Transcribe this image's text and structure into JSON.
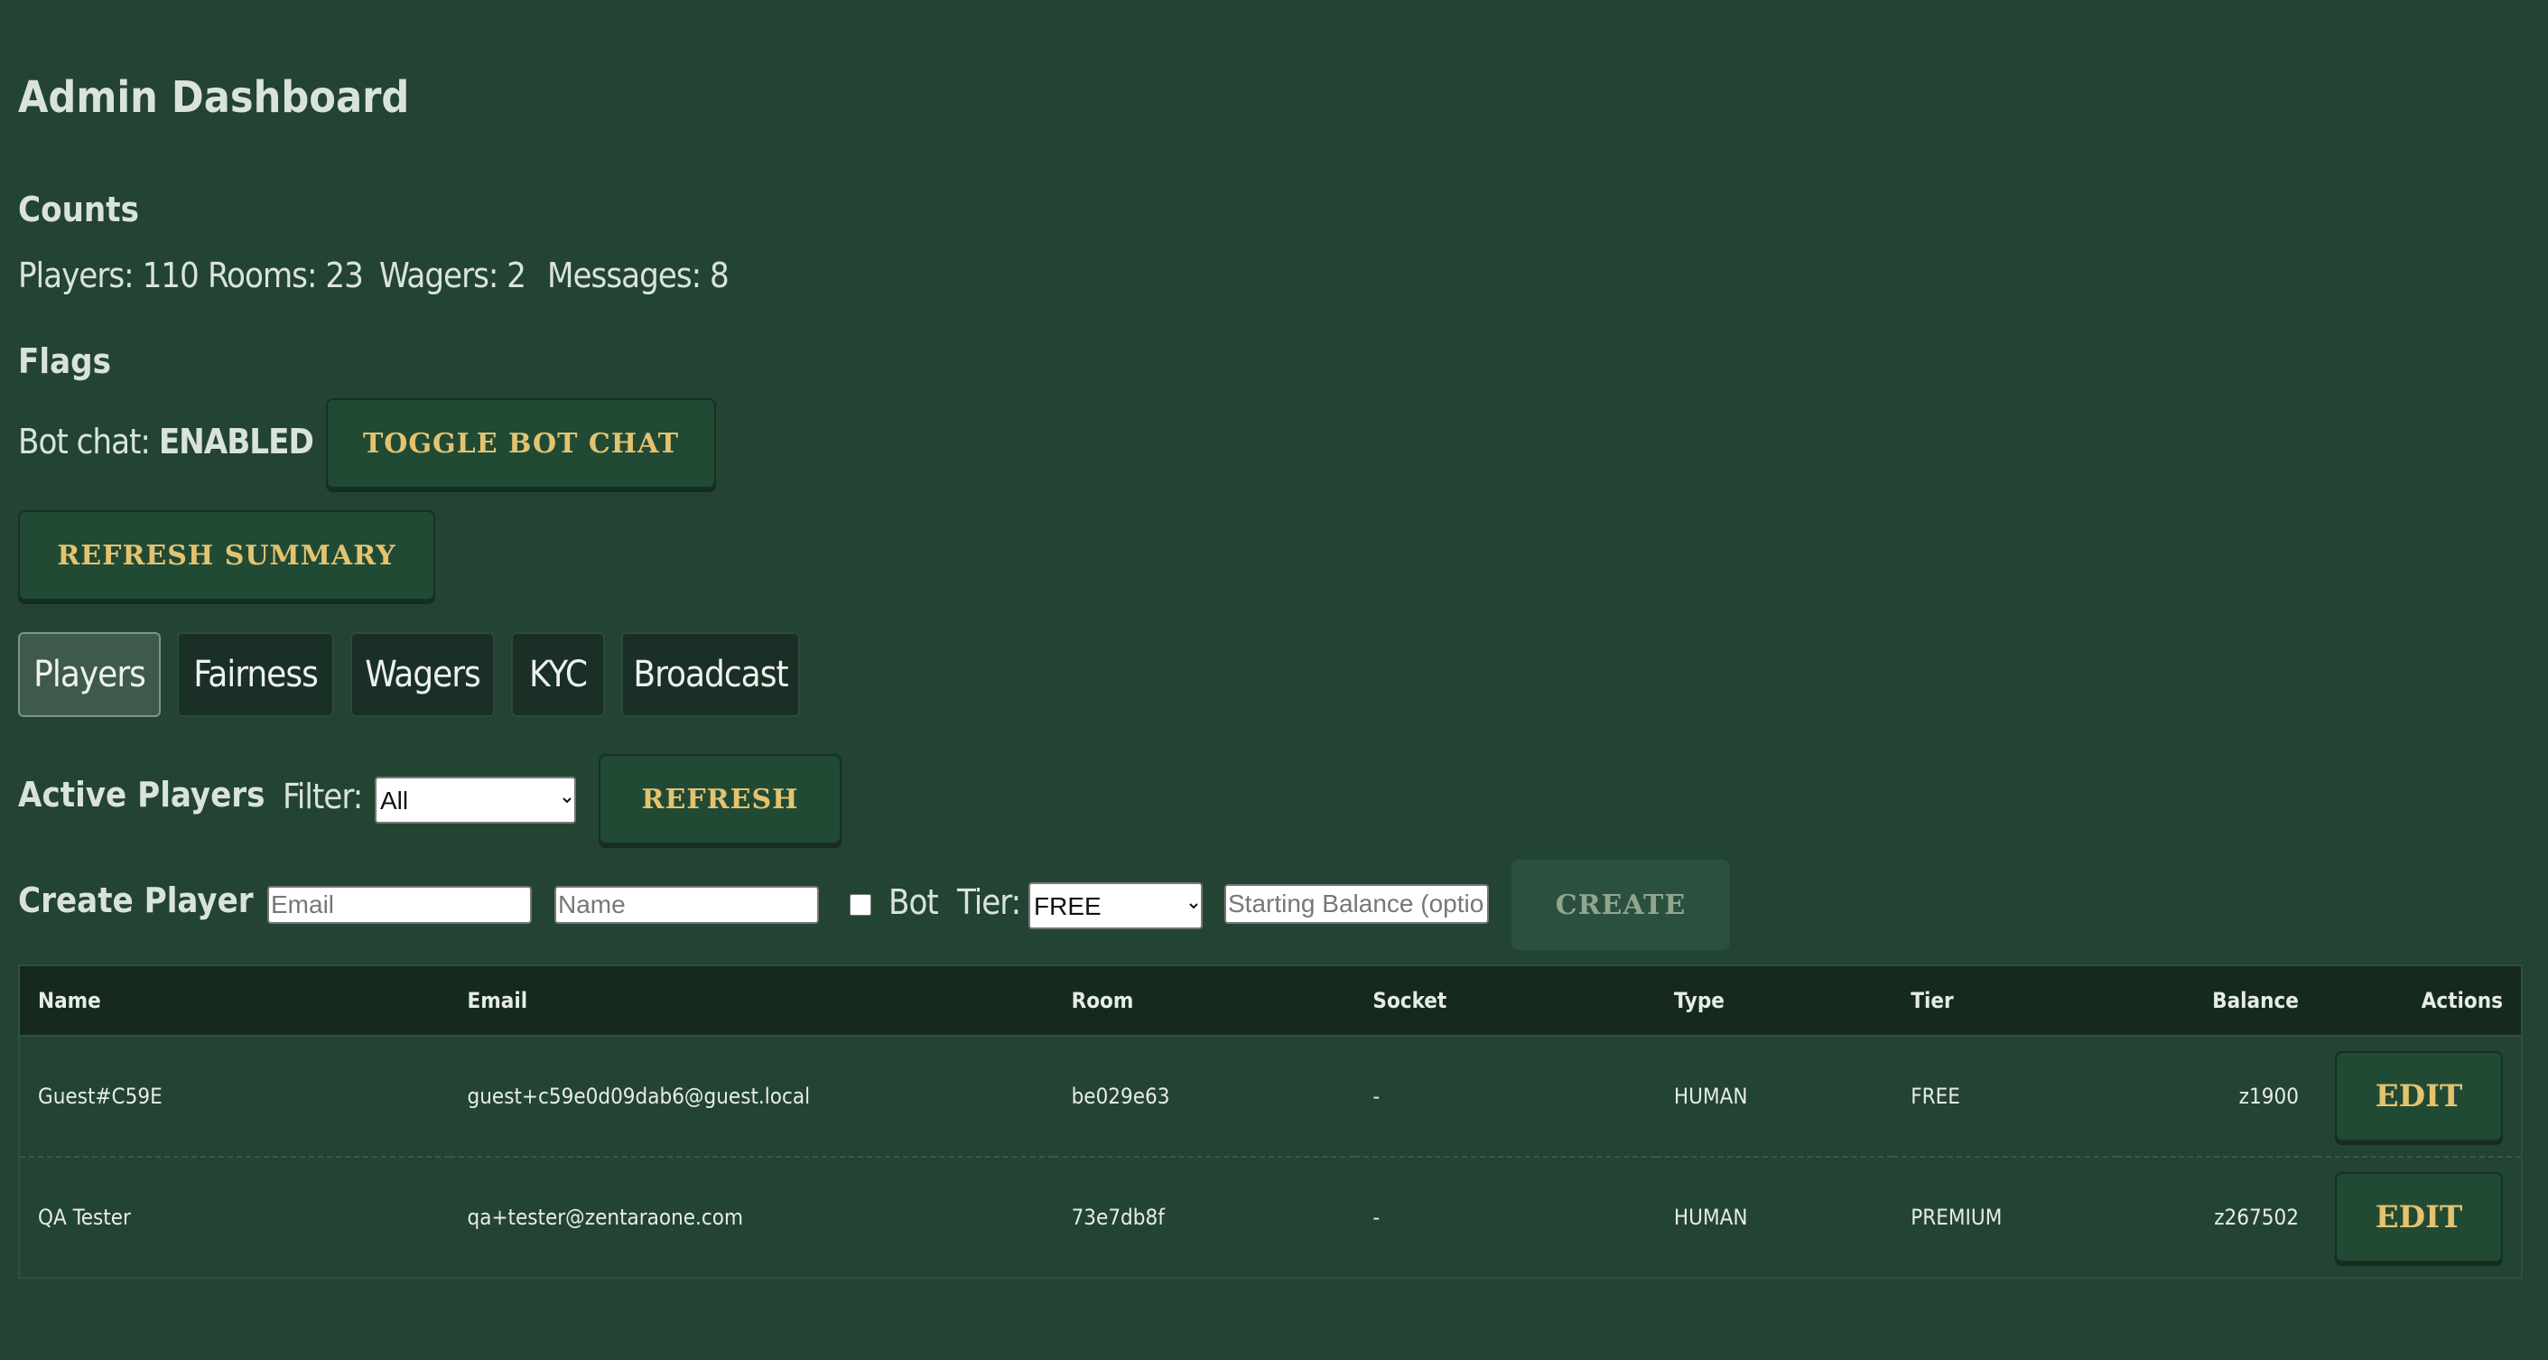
{
  "page": {
    "title": "Admin Dashboard"
  },
  "counts": {
    "heading": "Counts",
    "players": "Players: 110",
    "rooms": "Rooms: 23",
    "wagers": "Wagers: 2",
    "messages": "Messages: 8"
  },
  "flags": {
    "heading": "Flags",
    "bot_chat_label": "Bot chat:",
    "bot_chat_value": "ENABLED",
    "toggle_label": "TOGGLE BOT CHAT"
  },
  "refresh_summary_label": "REFRESH SUMMARY",
  "tabs": [
    {
      "label": "Players",
      "active": true
    },
    {
      "label": "Fairness"
    },
    {
      "label": "Wagers"
    },
    {
      "label": "KYC"
    },
    {
      "label": "Broadcast"
    }
  ],
  "active_players": {
    "heading": "Active Players",
    "filter_label": "Filter:",
    "filter_value": "All",
    "refresh_label": "REFRESH"
  },
  "create_player": {
    "heading": "Create Player",
    "email_placeholder": "Email",
    "name_placeholder": "Name",
    "bot_label": "Bot",
    "tier_label": "Tier:",
    "tier_value": "FREE",
    "balance_placeholder": "Starting Balance (optional)",
    "create_label": "CREATE"
  },
  "table": {
    "columns": [
      "Name",
      "Email",
      "Room",
      "Socket",
      "Type",
      "Tier",
      "Balance",
      "Actions"
    ],
    "rows": [
      {
        "name": "Guest#C59E",
        "email": "guest+c59e0d09dab6@guest.local",
        "room": "be029e63",
        "socket": "-",
        "type": "HUMAN",
        "tier": "FREE",
        "balance": "z1900",
        "action": "EDIT"
      },
      {
        "name": "QA Tester",
        "email": "qa+tester@zentaraone.com",
        "room": "73e7db8f",
        "socket": "-",
        "type": "HUMAN",
        "tier": "PREMIUM",
        "balance": "z267502",
        "action": "EDIT"
      }
    ]
  },
  "colors": {
    "background": "#234333",
    "button_text": "#e5c36e",
    "header_row": "#16291f"
  }
}
